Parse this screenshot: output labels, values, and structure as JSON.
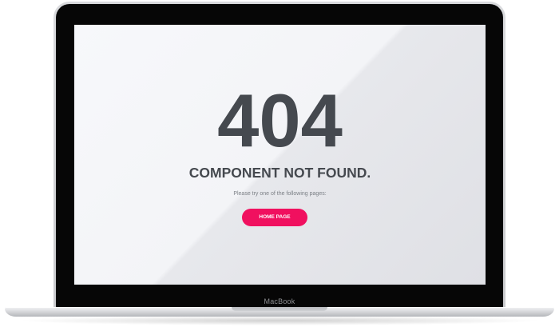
{
  "page": {
    "error_code": "404",
    "title": "COMPONENT NOT FOUND.",
    "subtitle": "Please try one of the following pages:",
    "home_button_label": "HOME PAGE"
  },
  "device": {
    "brand_label": "MacBook"
  },
  "colors": {
    "accent": "#f0105f",
    "text_dark": "#45494f",
    "text_muted": "#7b7f85",
    "bezel": "#060606"
  }
}
